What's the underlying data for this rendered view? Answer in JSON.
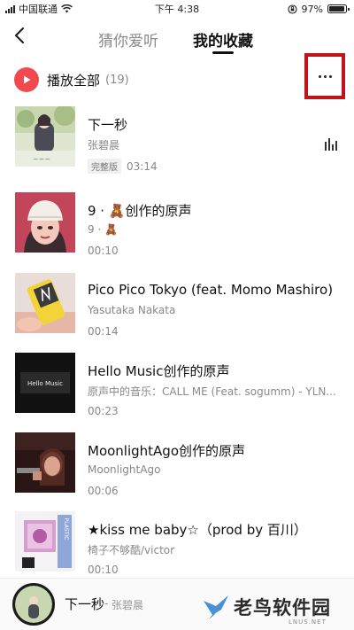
{
  "status_bar": {
    "carrier": "中国联通",
    "time": "下午 4:38",
    "battery": "97%",
    "battery_level": 0.97
  },
  "nav": {
    "tabs": [
      {
        "label": "猜你爱听",
        "active": false
      },
      {
        "label": "我的收藏",
        "active": true
      }
    ]
  },
  "play_all": {
    "label": "播放全部",
    "count": "(19)"
  },
  "songs": [
    {
      "title": "下一秒",
      "artist": "张碧晨",
      "badge": "完整版",
      "duration": "03:14",
      "playing": true,
      "cover": "girl-garden-cover"
    },
    {
      "title": "9 · 🧸创作的原声",
      "artist": "9 · 🧸",
      "duration": "00:10",
      "cover": "beanie-girl-cover"
    },
    {
      "title": "Pico Pico Tokyo (feat. Momo Mashiro)",
      "artist": "Yasutaka Nakata",
      "duration": "00:14",
      "cover": "yellow-phone-cover"
    },
    {
      "title": "Hello Music创作的原声",
      "artist": "原声中的音乐：CALL ME (Feat. sogumm) - YLN...",
      "duration": "00:23",
      "cover": "hello-music-cover"
    },
    {
      "title": "MoonlightAgo创作的原声",
      "artist": "MoonlightAgo",
      "duration": "00:06",
      "cover": "moonlight-cover"
    },
    {
      "title": "★kiss me baby☆（prod by 百川）",
      "artist": "椅子不够酷/victor",
      "duration": "00:10",
      "cover": "plastic-hearts-cover"
    }
  ],
  "mini_player": {
    "title": "下一秒",
    "separator": "-",
    "artist": "张碧晨"
  },
  "watermark": {
    "text": "老鸟软件园",
    "sub": "LNUS.NET"
  },
  "colors": {
    "accent": "#f04a4e",
    "highlight_box": "#c0141a"
  }
}
